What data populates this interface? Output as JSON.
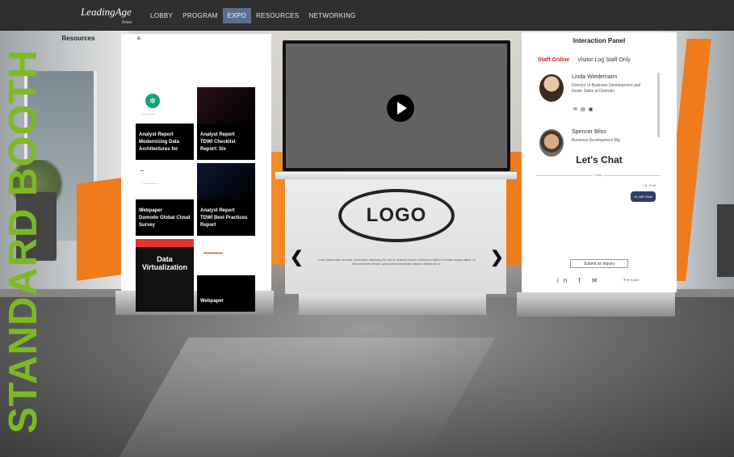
{
  "header": {
    "logo_text": "LeadingAge",
    "logo_sub": "Iowa",
    "nav": [
      "LOBBY",
      "PROGRAM",
      "EXPO",
      "RESOURCES",
      "NETWORKING"
    ],
    "active_nav": "EXPO"
  },
  "watermark": "STANDARD BOOTH",
  "resources": {
    "title": "Resources",
    "tiles": [
      {
        "label": "Analyst Report\nModernizing Data Architectures for"
      },
      {
        "label": "Analyst Report\nTDWI Checklist Report: Six"
      },
      {
        "label": "Webpaper\nDomodo Global Cloud Survey"
      },
      {
        "label": "Analyst Report\nTDWI Best Practices Report"
      },
      {
        "label": "Data Virtualization"
      },
      {
        "label": "Webpaper"
      }
    ]
  },
  "booth": {
    "logo": "LOGO",
    "prev_icon": "chevron-left-icon",
    "next_icon": "chevron-right-icon",
    "description": "Lorem ipsum dolor sit amet, consectetur adipiscing elit, sed do eiusmod tempor incididunt ut labore et dolore magna aliqua. Ut enim ad minim veniam, quis nostrud exercitation ullamco laboris nisi ut."
  },
  "interaction": {
    "title": "Interaction Panel",
    "tabs": [
      "Staff Online",
      "Visitor Log Staff Only"
    ],
    "people": [
      {
        "name": "Linda Wiedemann",
        "title": "Director of Business Development and Inside Sales at Domodo"
      },
      {
        "name": "Spencer Bliss",
        "title": "Business Development Mg"
      }
    ],
    "chat_title": "Let's Chat",
    "chat_day": "Today",
    "chat_meta": "LB, Chat",
    "chat_bubble": "Hi, Mill Chart",
    "chat_input": "Submit an inquiry",
    "social_icons": "in f ✉",
    "share_label": "✉ ➦ Share"
  }
}
